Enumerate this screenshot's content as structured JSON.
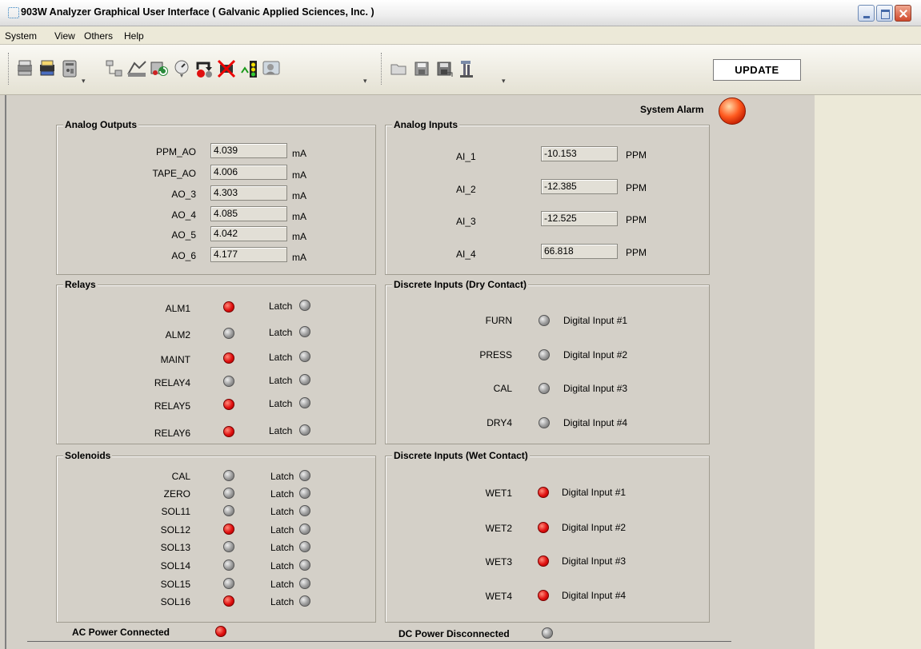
{
  "window": {
    "title": "903W Analyzer Graphical User Interface  ( Galvanic Applied Sciences, Inc. )"
  },
  "menu": [
    "System",
    "View",
    "Others",
    "Help"
  ],
  "toolbar": {
    "icons": [
      "print-icon",
      "print-setup-icon",
      "device-icon",
      "tree-icon",
      "chart-icon",
      "refresh-icon",
      "gauge-icon",
      "loop-icon",
      "disconnect-icon",
      "traffic-light-icon",
      "user-icon",
      "folder-open-icon",
      "save-icon",
      "save-as-icon",
      "hammer-icon"
    ],
    "update_label": "UPDATE"
  },
  "system_alarm": {
    "label": "System Alarm",
    "color": "#ff5a1f"
  },
  "analog_outputs": {
    "title": "Analog Outputs",
    "unit": "mA",
    "rows": [
      {
        "name": "PPM_AO",
        "value": "4.039"
      },
      {
        "name": "TAPE_AO",
        "value": "4.006"
      },
      {
        "name": "AO_3",
        "value": "4.303"
      },
      {
        "name": "AO_4",
        "value": "4.085"
      },
      {
        "name": "AO_5",
        "value": "4.042"
      },
      {
        "name": "AO_6",
        "value": "4.177"
      }
    ]
  },
  "analog_inputs": {
    "title": "Analog Inputs",
    "unit": "PPM",
    "rows": [
      {
        "name": "AI_1",
        "value": "-10.153"
      },
      {
        "name": "AI_2",
        "value": "-12.385"
      },
      {
        "name": "AI_3",
        "value": "-12.525"
      },
      {
        "name": "AI_4",
        "value": "66.818"
      }
    ]
  },
  "relays": {
    "title": "Relays",
    "latch_label": "Latch",
    "rows": [
      {
        "name": "ALM1",
        "state": "red"
      },
      {
        "name": "ALM2",
        "state": "gray"
      },
      {
        "name": "MAINT",
        "state": "red"
      },
      {
        "name": "RELAY4",
        "state": "gray"
      },
      {
        "name": "RELAY5",
        "state": "red"
      },
      {
        "name": "RELAY6",
        "state": "red"
      }
    ]
  },
  "dry_inputs": {
    "title": "Discrete Inputs (Dry Contact)",
    "rows": [
      {
        "name": "FURN",
        "state": "gray",
        "label": "Digital Input #1"
      },
      {
        "name": "PRESS",
        "state": "gray",
        "label": "Digital Input #2"
      },
      {
        "name": "CAL",
        "state": "gray",
        "label": "Digital Input #3"
      },
      {
        "name": "DRY4",
        "state": "gray",
        "label": "Digital Input #4"
      }
    ]
  },
  "solenoids": {
    "title": "Solenoids",
    "latch_label": "Latch",
    "rows": [
      {
        "name": "CAL",
        "state": "gray"
      },
      {
        "name": "ZERO",
        "state": "gray"
      },
      {
        "name": "SOL11",
        "state": "gray"
      },
      {
        "name": "SOL12",
        "state": "red"
      },
      {
        "name": "SOL13",
        "state": "gray"
      },
      {
        "name": "SOL14",
        "state": "gray"
      },
      {
        "name": "SOL15",
        "state": "gray"
      },
      {
        "name": "SOL16",
        "state": "red"
      }
    ]
  },
  "wet_inputs": {
    "title": "Discrete Inputs (Wet Contact)",
    "rows": [
      {
        "name": "WET1",
        "state": "red",
        "label": "Digital Input #1"
      },
      {
        "name": "WET2",
        "state": "red",
        "label": "Digital Input #2"
      },
      {
        "name": "WET3",
        "state": "red",
        "label": "Digital Input #3"
      },
      {
        "name": "WET4",
        "state": "red",
        "label": "Digital Input #4"
      }
    ]
  },
  "power": {
    "ac": {
      "label": "AC Power Connected",
      "state": "red"
    },
    "dc": {
      "label": "DC Power Disconnected",
      "state": "gray"
    }
  }
}
